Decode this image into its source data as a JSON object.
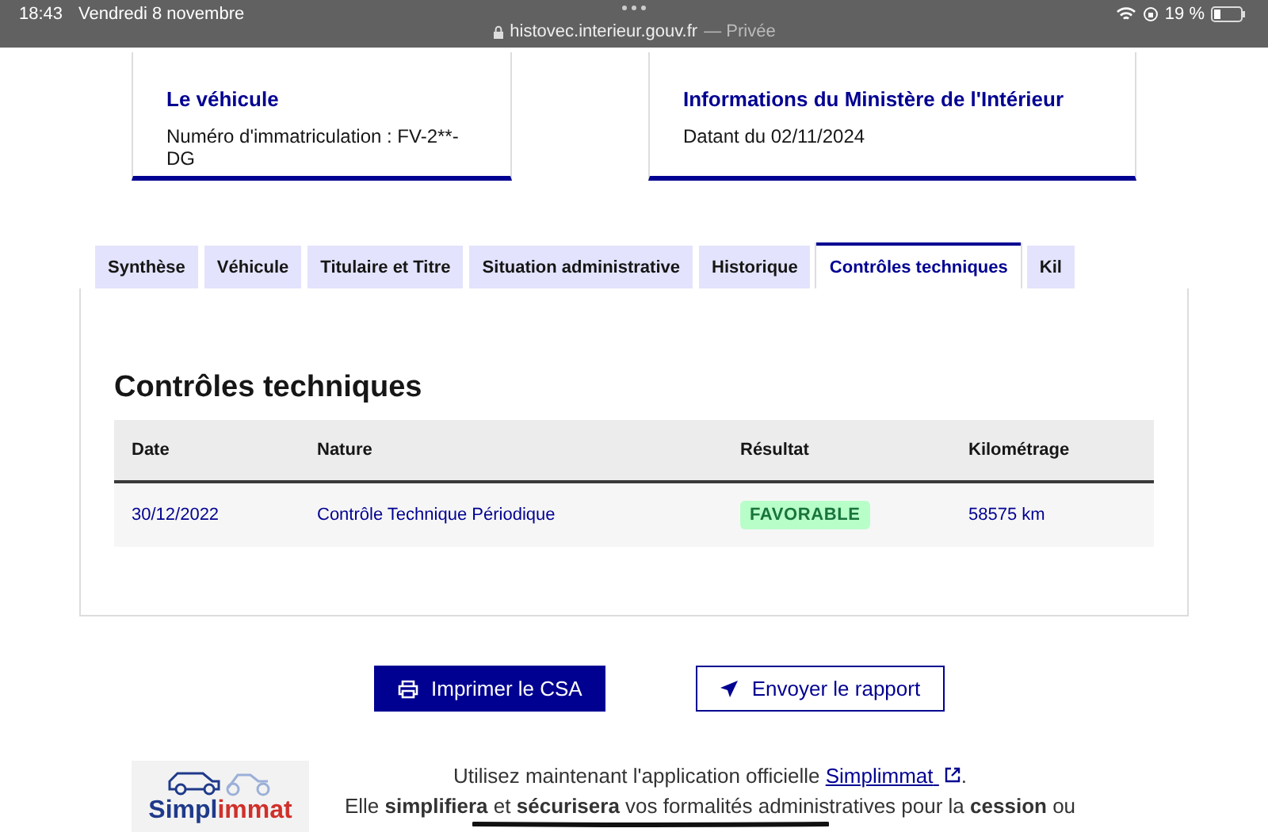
{
  "status_bar": {
    "time": "18:43",
    "date": "Vendredi 8 novembre",
    "url": "histovec.interieur.gouv.fr",
    "private_label": "— Privée",
    "battery": "19 %"
  },
  "cards": [
    {
      "title": "Le véhicule",
      "text": "Numéro d'immatriculation : FV-2**-DG"
    },
    {
      "title": "Informations du Ministère de l'Intérieur",
      "text": "Datant du 02/11/2024"
    }
  ],
  "tabs": [
    {
      "label": "Synthèse",
      "selected": false
    },
    {
      "label": "Véhicule",
      "selected": false
    },
    {
      "label": "Titulaire et Titre",
      "selected": false
    },
    {
      "label": "Situation administrative",
      "selected": false
    },
    {
      "label": "Historique",
      "selected": false
    },
    {
      "label": "Contrôles techniques",
      "selected": true
    },
    {
      "label": "Kil",
      "selected": false
    }
  ],
  "section_title": "Contrôles techniques",
  "table": {
    "columns": [
      "Date",
      "Nature",
      "Résultat",
      "Kilométrage"
    ],
    "rows": [
      {
        "date": "30/12/2022",
        "nature": "Contrôle Technique Périodique",
        "result": "FAVORABLE",
        "mileage": "58575 km"
      }
    ]
  },
  "buttons": [
    {
      "label": "Imprimer le CSA",
      "kind": "primary"
    },
    {
      "label": "Envoyer le rapport",
      "kind": "secondary"
    }
  ],
  "promo": {
    "logo_parts": [
      "Simpl",
      "immat"
    ],
    "intro": "Utilisez maintenant l'application officielle",
    "link": "Simplimmat",
    "intro_end": ".",
    "text": "Elle **simplifiera** et **sécurisera** vos formalités administratives pour la **cession** ou"
  }
}
